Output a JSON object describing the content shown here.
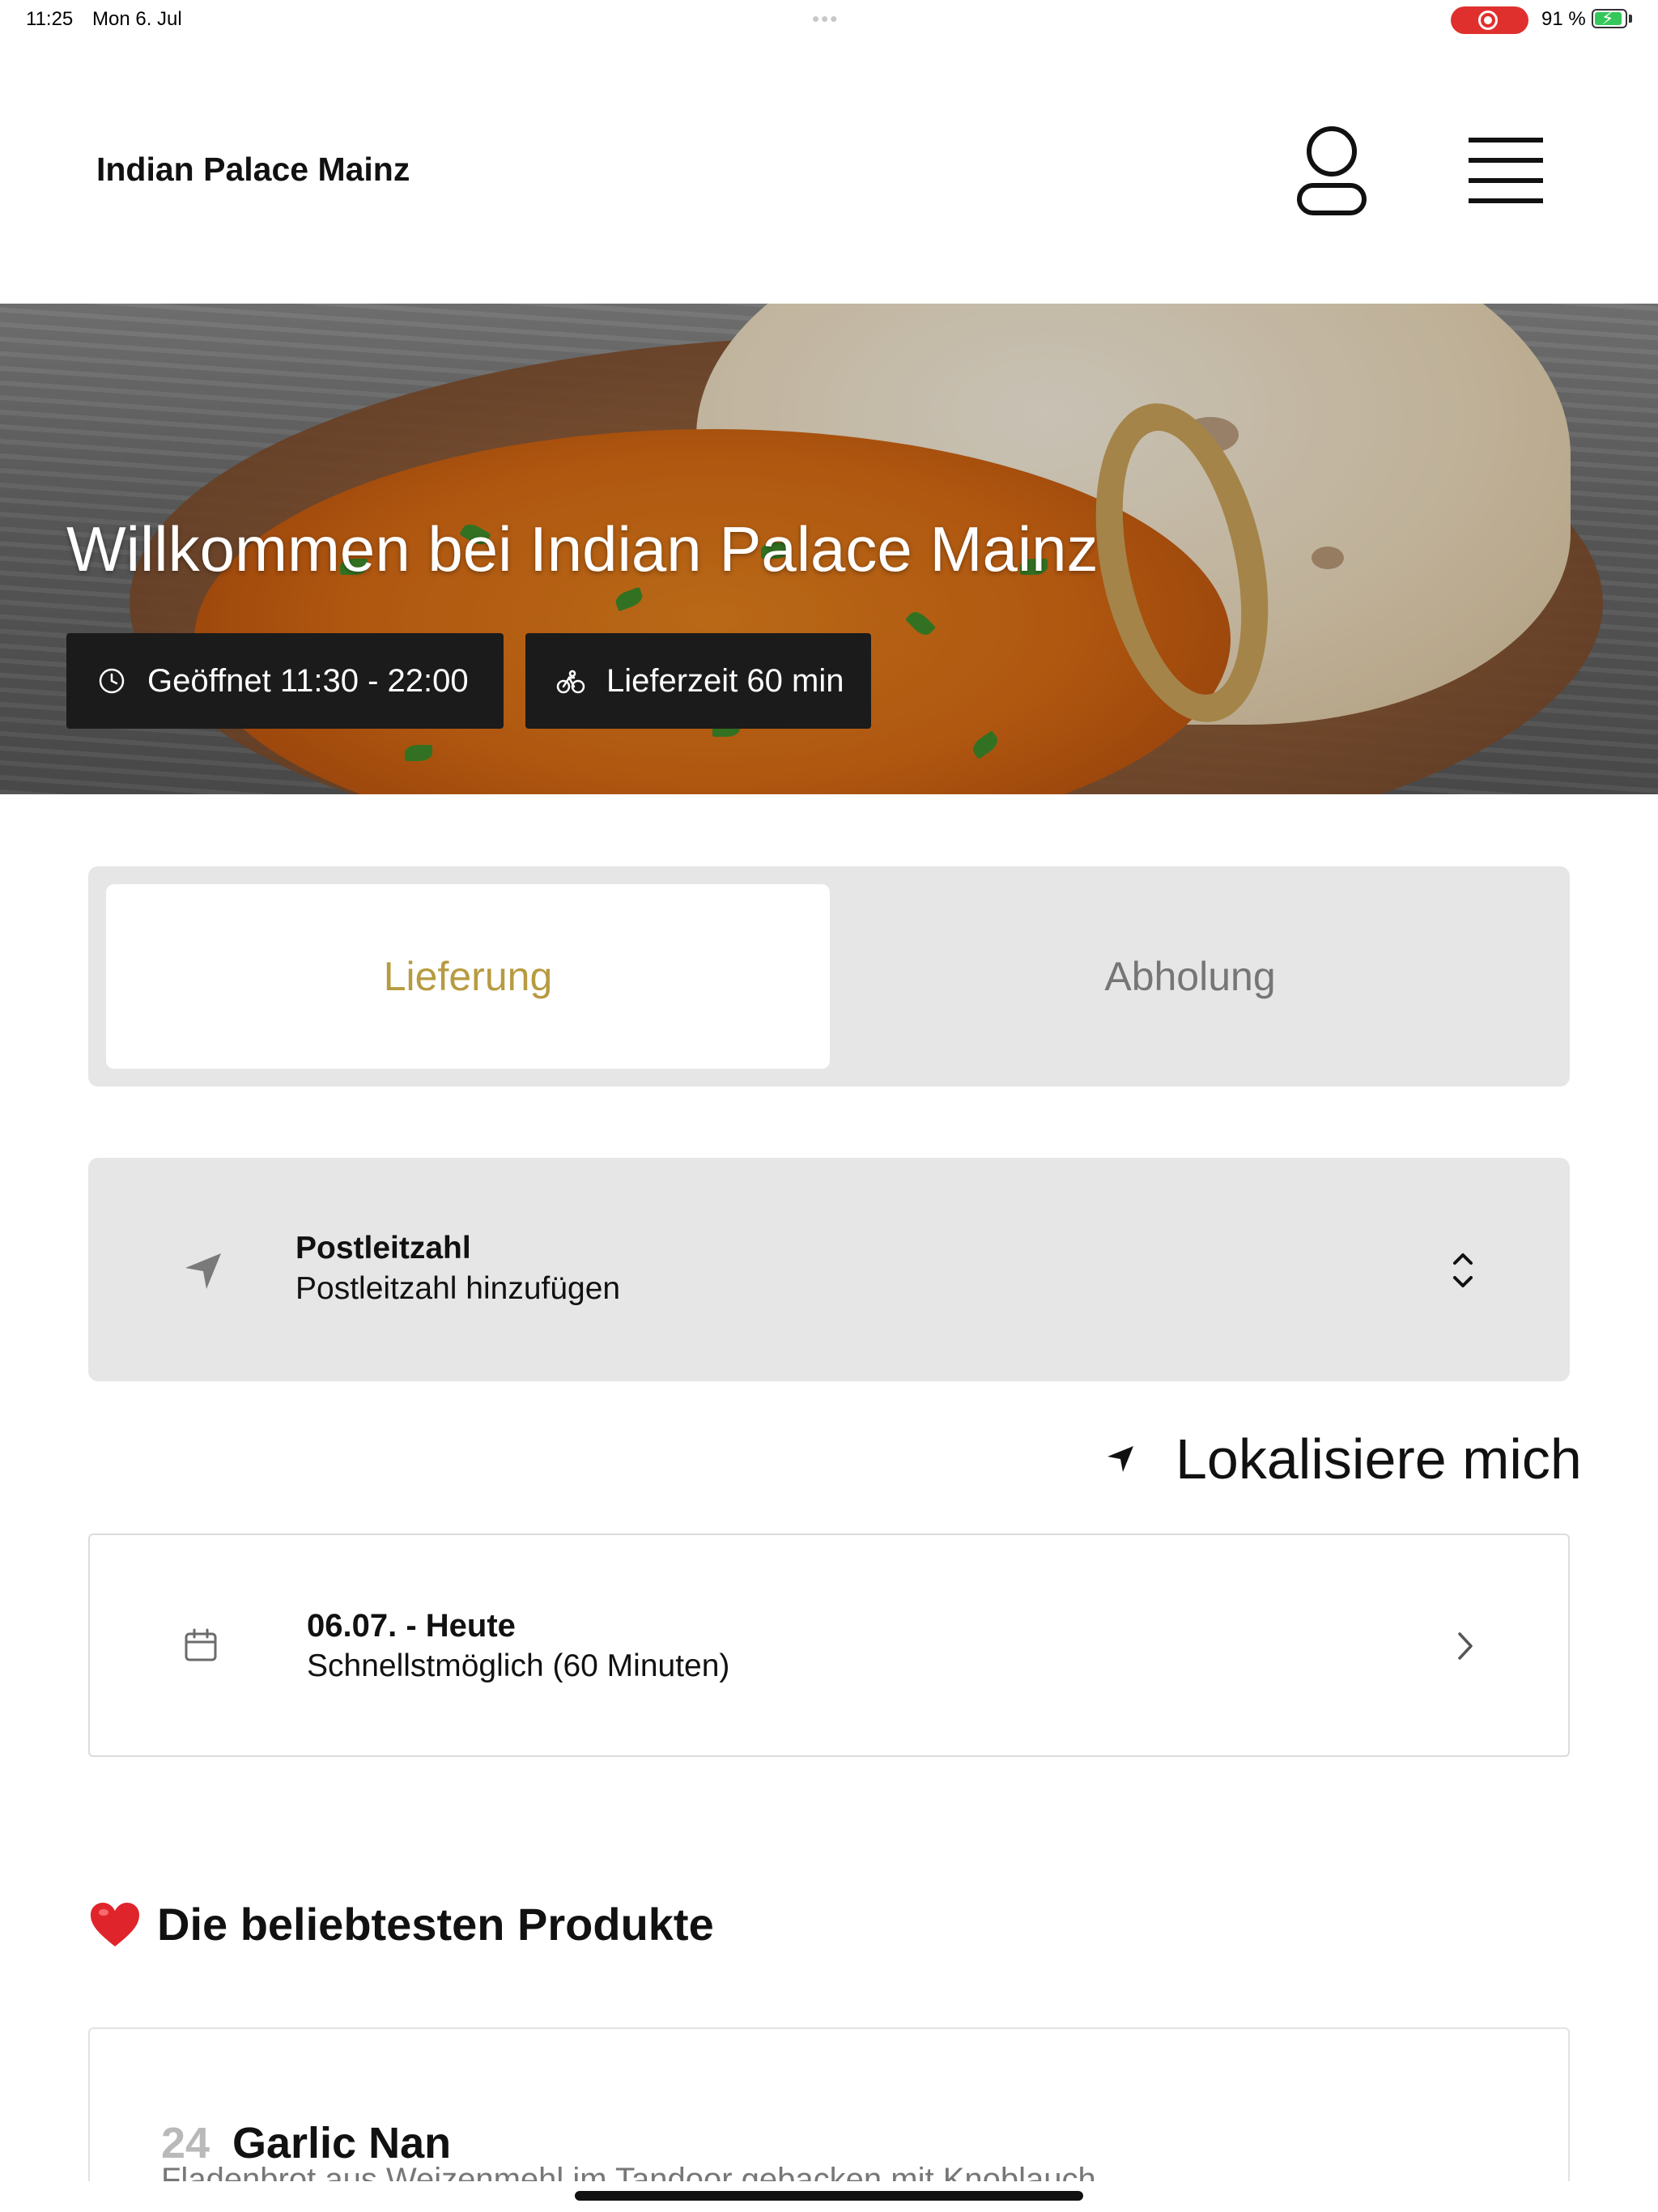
{
  "status_bar": {
    "time": "11:25",
    "date": "Mon 6. Jul",
    "dots": "•••",
    "battery_percent": "91 %",
    "battery_level": 0.91
  },
  "header": {
    "title": "Indian Palace Mainz",
    "account_icon": "user-icon",
    "menu_icon": "hamburger-menu-icon"
  },
  "hero": {
    "title": "Willkommen bei Indian Palace Mainz",
    "open_badge": {
      "icon": "clock-icon",
      "label": "Geöffnet 11:30 - 22:00"
    },
    "delivery_badge": {
      "icon": "bicycle-icon",
      "label": "Lieferzeit 60 min"
    }
  },
  "order_mode": {
    "tabs": [
      {
        "label": "Lieferung",
        "selected": true
      },
      {
        "label": "Abholung",
        "selected": false
      }
    ],
    "accent_color": "#b79b41"
  },
  "postal_code": {
    "icon": "location-arrow-icon",
    "label": "Postleitzahl",
    "placeholder": "Postleitzahl hinzufügen",
    "chevron_icon": "chevron-up-down-icon"
  },
  "locate": {
    "icon": "location-arrow-icon",
    "label": "Lokalisiere mich"
  },
  "schedule": {
    "icon": "calendar-icon",
    "label": "06.07. - Heute",
    "value": "Schnellstmöglich (60 Minuten)",
    "chevron_icon": "chevron-right-icon"
  },
  "popular": {
    "icon": "heart-icon",
    "title": "Die beliebtesten Produkte",
    "products": [
      {
        "number": "24",
        "name": "Garlic Nan",
        "description": "Fladenbrot aus Weizenmehl im Tandoor gebacken mit Knoblauch"
      }
    ]
  }
}
